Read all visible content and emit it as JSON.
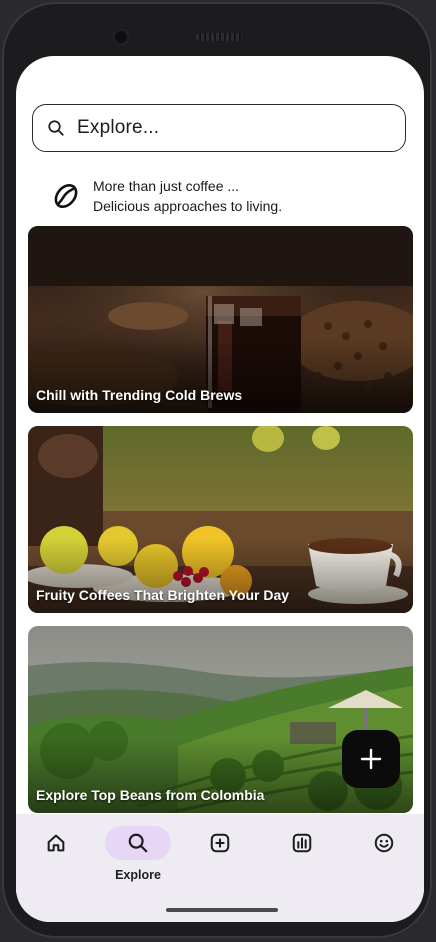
{
  "search": {
    "placeholder": "Explore..."
  },
  "tagline": {
    "line1": "More than just coffee ...",
    "line2": "Delicious approaches to living."
  },
  "cards": [
    {
      "label": "Chill with Trending Cold Brews"
    },
    {
      "label": "Fruity Coffees That Brighten Your Day"
    },
    {
      "label": "Explore Top Beans from Colombia"
    }
  ],
  "fab": {
    "icon": "plus-icon"
  },
  "nav": {
    "items": [
      {
        "icon": "home-icon",
        "label": ""
      },
      {
        "icon": "search-icon",
        "label": "Explore",
        "active": true
      },
      {
        "icon": "add-box-icon",
        "label": ""
      },
      {
        "icon": "chart-icon",
        "label": ""
      },
      {
        "icon": "smiley-icon",
        "label": ""
      }
    ]
  },
  "colors": {
    "nav_background": "#efebf3",
    "active_pill": "#e8d6f6",
    "fab": "#0b0b0b"
  }
}
